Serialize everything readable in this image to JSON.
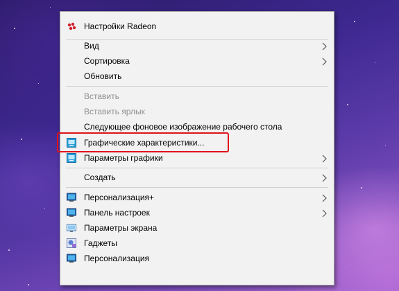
{
  "menu": {
    "radeon": {
      "label": "Настройки Radeon",
      "icon": "amd-radeon-icon"
    },
    "view": {
      "label": "Вид",
      "icon": "chevron-right-icon"
    },
    "sort": {
      "label": "Сортировка",
      "icon": "chevron-right-icon"
    },
    "refresh": {
      "label": "Обновить"
    },
    "paste": {
      "label": "Вставить",
      "disabled": true
    },
    "paste_shortcut": {
      "label": "Вставить ярлык",
      "disabled": true
    },
    "next_background": {
      "label": "Следующее фоновое изображение рабочего стола"
    },
    "graphics_properties": {
      "label": "Графические характеристики...",
      "icon": "intel-graphics-icon"
    },
    "graphics_options": {
      "label": "Параметры графики",
      "icon": "intel-graphics-icon"
    },
    "create": {
      "label": "Создать"
    },
    "personalization_plus": {
      "label": "Персонализация+",
      "icon": "monitor-icon"
    },
    "control_panel": {
      "label": "Панель настроек",
      "icon": "monitor-icon"
    },
    "screen_settings": {
      "label": "Параметры экрана",
      "icon": "display-icon"
    },
    "gadgets": {
      "label": "Гаджеты",
      "icon": "gadgets-icon"
    },
    "personalization": {
      "label": "Персонализация",
      "icon": "monitor-icon"
    }
  },
  "colors": {
    "highlight_border": "#e0121b",
    "menu_background": "#f2f2f2",
    "disabled_text": "#8e8e8e"
  }
}
